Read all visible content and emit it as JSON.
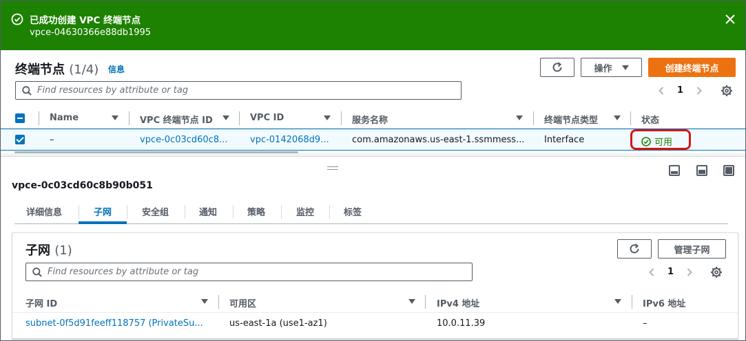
{
  "flash": {
    "title": "已成功创建 VPC 终端节点",
    "subtitle": "vpce-04630366e88db1995",
    "color": "#1d8102"
  },
  "top": {
    "title": "终端节点",
    "count": "(1/4)",
    "info": "信息",
    "actions_label": "操作",
    "create_label": "创建终端节点",
    "search_placeholder": "Find resources by attribute or tag",
    "page": "1",
    "columns": [
      "Name",
      "VPC 终端节点 ID",
      "VPC ID",
      "服务名称",
      "终端节点类型",
      "状态"
    ],
    "row": {
      "name": "–",
      "endpoint_id": "vpce-0c03cd60c8...",
      "vpc_id": "vpc-0142068d9...",
      "service": "com.amazonaws.us-east-1.ssmmess...",
      "type": "Interface",
      "status": "可用"
    }
  },
  "split": {
    "title": "vpce-0c03cd60c8b90b051",
    "tabs": [
      "详细信息",
      "子网",
      "安全组",
      "通知",
      "策略",
      "监控",
      "标签"
    ],
    "active_tab": "子网"
  },
  "subnets": {
    "title": "子网",
    "count": "(1)",
    "manage_label": "管理子网",
    "search_placeholder": "Find resources by attribute or tag",
    "page": "1",
    "columns": [
      "子网 ID",
      "可用区",
      "IPv4 地址",
      "IPv6 地址"
    ],
    "row": {
      "subnet_id": "subnet-0f5d91feeff118757 (PrivateSu...",
      "az": "us-east-1a (use1-az1)",
      "ipv4": "10.0.11.39",
      "ipv6": "–"
    }
  },
  "colors": {
    "link": "#0073bb",
    "primary": "#ec7211",
    "success": "#1d8102",
    "highlight": "#d91515"
  }
}
